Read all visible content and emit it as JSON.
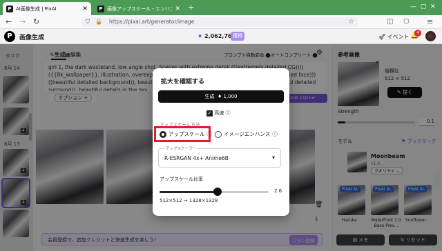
{
  "browser": {
    "tabs": [
      {
        "label": "AI画像生成 | PixAI",
        "close": "✕"
      },
      {
        "label": "画像アップスケール・エンハンス | Pix",
        "close": "✕"
      }
    ],
    "new_tab": "+",
    "url": "https://pixai.art/generator/image"
  },
  "header": {
    "title": "画像生成",
    "credits": "2,062,761",
    "credits_button": "獲得",
    "event": "イベント",
    "notif_count": "4"
  },
  "left": {
    "tab_label": "タスク",
    "dates": [
      "8月 14",
      "8月 13"
    ],
    "counts": [
      "4",
      "4",
      "4"
    ]
  },
  "center": {
    "tabs": [
      "生成",
      "編集"
    ],
    "prompt_auto": "プロンプト自動変換",
    "autocomplete": "オートコンプリート",
    "prompt_text": "girl 1, the dark wasteland, low angle shot, Scenes with extreme detail (((extremely detailed CG)))) ({{8k_wallpaper}}, illustration, overexposure, (((beautiful detailed eyes))), (((beautiful detailed face))) ((beautiful detailed background)), beautiful detailed skin,((beautiful detailed eyes)),((beautiful detailed surround)), beautiful details in the sky",
    "options_label": "オプション +",
    "gen_count": "200",
    "gen_shortcut": "Ctrl+↵",
    "footer_text": "会員登録で、追加クレジットと快速生成を楽しう！",
    "footer_button": "プラン登録"
  },
  "modal": {
    "title": "拡大を確認する",
    "generate_label": "生成",
    "generate_cost": "1,000",
    "fast_label": "高速",
    "method_label": "アップスケール方法",
    "option_upscale": "アップスケール",
    "option_enhance": "イメージエンハンス",
    "upscaler_label": "アップスケーラー",
    "upscaler_value": "R-ESRGAN 4x+ Anime6B",
    "ratio_label": "アップスケール比率",
    "ratio_value": "2.6",
    "ratio_min": 1,
    "ratio_max": 4,
    "size_text": "512×512 → 1328×1328"
  },
  "right": {
    "ref_title": "参考画像",
    "ref_type": "縦横比",
    "ref_size": "512 × 512",
    "draw_button": "描く",
    "strength_label": "Strength",
    "strength_value": "0.1",
    "strength_fraction": 0.1,
    "model_label": "モデル",
    "bookmark": "ブックマーク",
    "model_name": "Moonbeam",
    "model_version": "v1.0",
    "model_quality": "クオリティ",
    "loras": [
      {
        "badge": "PixAI XL",
        "name": "Haruka"
      },
      {
        "badge": "PixAI XL",
        "name": "Waterfront 1.0 Base Prev..."
      },
      {
        "badge": "PixAI XL",
        "name": "Sunflower"
      }
    ],
    "memo": "メモ",
    "reset": "リセット"
  },
  "colors": {
    "tabbar": "#4b9a55",
    "highlight": "#e8182d",
    "purple": "#7a55d8"
  }
}
